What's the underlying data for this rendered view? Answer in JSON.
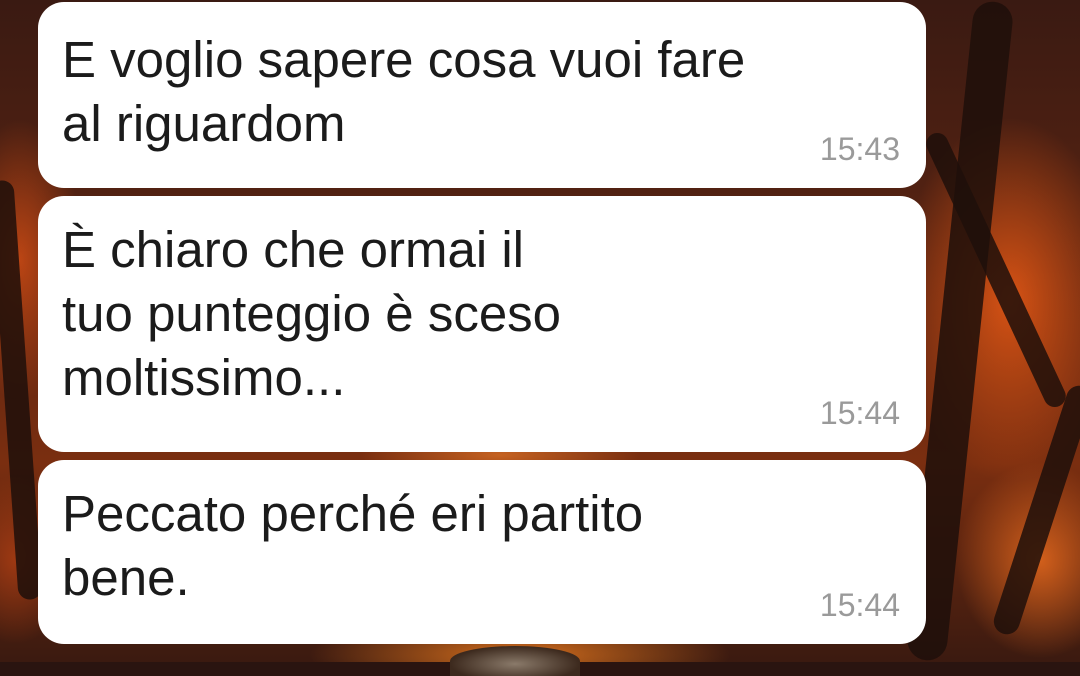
{
  "messages": [
    {
      "text": "E voglio sapere cosa vuoi fare\nal riguardom",
      "time": "15:43"
    },
    {
      "text": "È chiaro che ormai il\ntuo punteggio è sceso\nmoltissimo...",
      "time": "15:44"
    },
    {
      "text": "Peccato perché eri partito\nbene.",
      "time": "15:44"
    }
  ],
  "colors": {
    "bubble": "#ffffff",
    "text": "#1b1b1b",
    "time": "#9a9a9a"
  }
}
